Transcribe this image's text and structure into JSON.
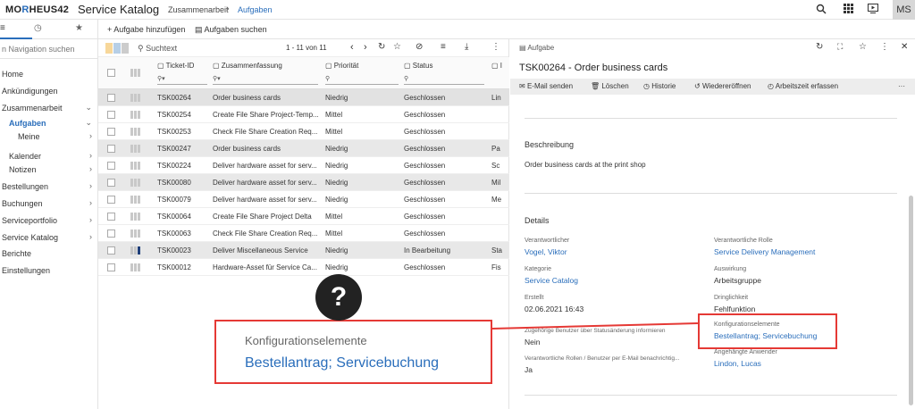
{
  "app": {
    "logo_left": "MO",
    "logo_accent": "R",
    "logo_right": "HEUS42",
    "title": "Service Katalog",
    "user_initials": "MS"
  },
  "breadcrumb": [
    "Zusammenarbeit",
    "Aufgaben"
  ],
  "top_icons": [
    "search-icon",
    "grid-icon",
    "play-icon",
    "more-vertical-icon"
  ],
  "sidebar": {
    "search_placeholder": "n Navigation suchen",
    "items": [
      {
        "label": "Home"
      },
      {
        "label": "Ankündigungen"
      },
      {
        "label": "Zusammenarbeit",
        "chevron": "down"
      },
      {
        "label": "Aufgaben",
        "chevron": "down",
        "active": true
      },
      {
        "label": "Meine",
        "chevron": "right"
      },
      {
        "label": "Kalender",
        "chevron": "right"
      },
      {
        "label": "Notizen",
        "chevron": "right"
      },
      {
        "label": "Bestellungen",
        "chevron": "right"
      },
      {
        "label": "Buchungen",
        "chevron": "right"
      },
      {
        "label": "Serviceportfolio",
        "chevron": "right"
      },
      {
        "label": "Service Katalog",
        "chevron": "right"
      },
      {
        "label": "Berichte"
      },
      {
        "label": "Einstellungen"
      }
    ]
  },
  "toolbar": {
    "add_task": "Aufgabe hinzufügen",
    "search_tasks": "Aufgaben suchen"
  },
  "list": {
    "search_placeholder": "Suchtext",
    "pagination": "1 - 11 von 11",
    "columns": [
      "Ticket-ID",
      "Zusammenfassung",
      "Priorität",
      "Status",
      "I"
    ],
    "rows": [
      {
        "id": "TSK00264",
        "summary": "Order business cards",
        "priority": "Niedrig",
        "status": "Geschlossen",
        "extra": "Lin"
      },
      {
        "id": "TSK00254",
        "summary": "Create File Share Project-Temp...",
        "priority": "Mittel",
        "status": "Geschlossen",
        "extra": ""
      },
      {
        "id": "TSK00253",
        "summary": "Check File Share Creation Req...",
        "priority": "Mittel",
        "status": "Geschlossen",
        "extra": ""
      },
      {
        "id": "TSK00247",
        "summary": "Order business cards",
        "priority": "Niedrig",
        "status": "Geschlossen",
        "extra": "Pa"
      },
      {
        "id": "TSK00224",
        "summary": "Deliver hardware asset for serv...",
        "priority": "Niedrig",
        "status": "Geschlossen",
        "extra": "Sc"
      },
      {
        "id": "TSK00080",
        "summary": "Deliver hardware asset for serv...",
        "priority": "Niedrig",
        "status": "Geschlossen",
        "extra": "Mil"
      },
      {
        "id": "TSK00079",
        "summary": "Deliver hardware asset for serv...",
        "priority": "Niedrig",
        "status": "Geschlossen",
        "extra": "Me"
      },
      {
        "id": "TSK00064",
        "summary": "Create File Share Project Delta",
        "priority": "Mittel",
        "status": "Geschlossen",
        "extra": ""
      },
      {
        "id": "TSK00063",
        "summary": "Check File Share Creation Req...",
        "priority": "Mittel",
        "status": "Geschlossen",
        "extra": ""
      },
      {
        "id": "TSK00023",
        "summary": "Deliver Miscellaneous Service",
        "priority": "Niedrig",
        "status": "In Bearbeitung",
        "extra": "Sta"
      },
      {
        "id": "TSK00012",
        "summary": "Hardware-Asset für Service Ca...",
        "priority": "Niedrig",
        "status": "Geschlossen",
        "extra": "Fis"
      }
    ]
  },
  "detail": {
    "header": "Aufgabe",
    "title": "TSK00264 - Order business cards",
    "actions": [
      "E-Mail senden",
      "Löschen",
      "Historie",
      "Wiedereröffnen",
      "Arbeitszeit erfassen"
    ],
    "description_title": "Beschreibung",
    "description": "Order business cards at the print shop",
    "details_title": "Details",
    "fields": {
      "responsible_label": "Verantwortlicher",
      "responsible_value": "Vogel, Viktor",
      "role_label": "Verantwortliche Rolle",
      "role_value": "Service Delivery Management",
      "category_label": "Kategorie",
      "category_value": "Service Catalog",
      "impact_label": "Auswirkung",
      "impact_value": "Arbeitsgruppe",
      "created_label": "Erstellt",
      "created_value": "02.06.2021 16:43",
      "urgency_label": "Dringlichkeit",
      "urgency_value": "Fehlfunktion",
      "config_label": "Konfigurationselemente",
      "config_value": "Bestellantrag; Servicebuchung",
      "notify_label": "Zugehörige Benutzer über Statusänderung informieren",
      "notify_value": "Nein",
      "appended_label": "Angehängte Anwender",
      "appended_value": "Lindon, Lucas",
      "roles_email_label": "Verantwortliche Rollen / Benutzer per E-Mail benachrichtig...",
      "roles_email_value": "Ja"
    }
  },
  "callout": {
    "symbol": "?",
    "label": "Konfigurationselemente",
    "value": "Bestellantrag; Servicebuchung"
  },
  "colors": {
    "accent": "#2a6ebb",
    "callout_red": "#e53935"
  }
}
